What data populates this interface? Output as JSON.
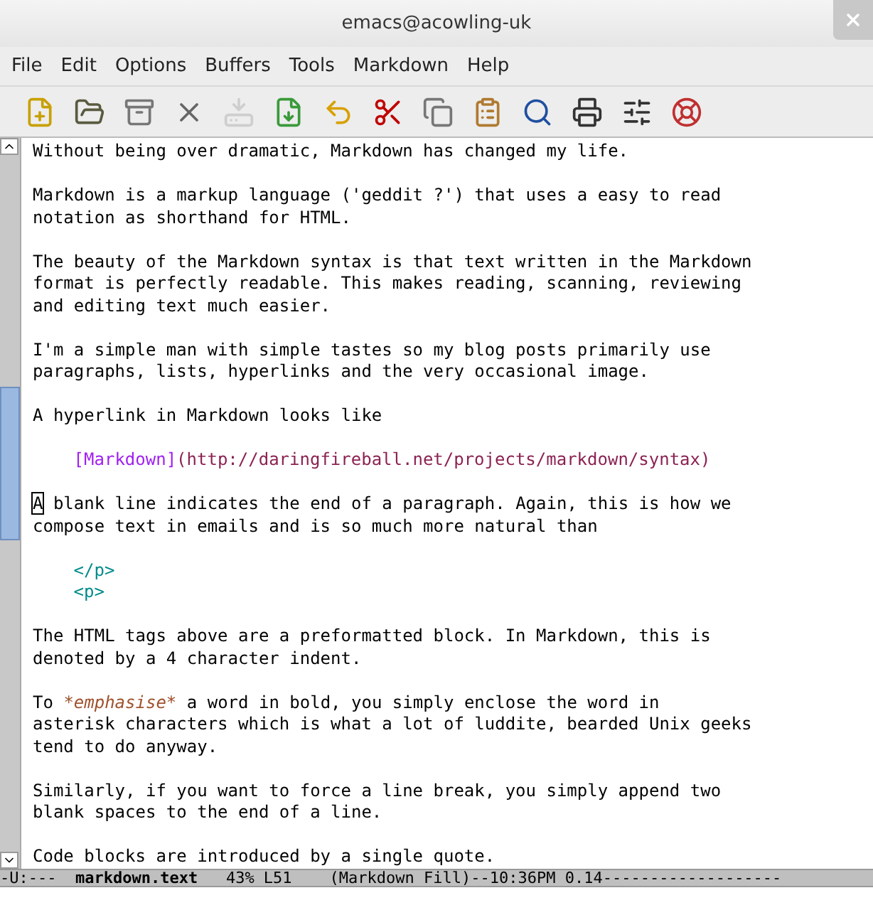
{
  "window": {
    "title": "emacs@acowling-uk"
  },
  "menu": [
    "File",
    "Edit",
    "Options",
    "Buffers",
    "Tools",
    "Markdown",
    "Help"
  ],
  "toolbar": [
    {
      "disabled": false
    },
    {
      "disabled": false
    },
    {
      "disabled": false
    },
    {
      "disabled": false
    },
    {
      "disabled": true
    },
    {
      "disabled": false
    },
    {
      "disabled": false
    },
    {
      "disabled": false
    },
    {
      "disabled": false
    },
    {
      "disabled": false
    },
    {
      "disabled": false
    },
    {
      "disabled": false
    },
    {
      "disabled": false
    },
    {
      "disabled": false
    }
  ],
  "buffer": {
    "lines": [
      {
        "kind": "text",
        "segments": [
          {
            "kind": "plain",
            "text": "Without being over dramatic, Markdown has changed my life."
          }
        ]
      },
      {
        "kind": "blank"
      },
      {
        "kind": "text",
        "segments": [
          {
            "kind": "plain",
            "text": "Markdown is a markup language ('geddit ?') that uses a easy to read"
          }
        ]
      },
      {
        "kind": "text",
        "segments": [
          {
            "kind": "plain",
            "text": "notation as shorthand for HTML."
          }
        ]
      },
      {
        "kind": "blank"
      },
      {
        "kind": "text",
        "segments": [
          {
            "kind": "plain",
            "text": "The beauty of the Markdown syntax is that text written in the Markdown"
          }
        ]
      },
      {
        "kind": "text",
        "segments": [
          {
            "kind": "plain",
            "text": "format is perfectly readable. This makes reading, scanning, reviewing"
          }
        ]
      },
      {
        "kind": "text",
        "segments": [
          {
            "kind": "plain",
            "text": "and editing text much easier."
          }
        ]
      },
      {
        "kind": "blank"
      },
      {
        "kind": "text",
        "segments": [
          {
            "kind": "plain",
            "text": "I'm a simple man with simple tastes so my blog posts primarily use"
          }
        ]
      },
      {
        "kind": "text",
        "segments": [
          {
            "kind": "plain",
            "text": "paragraphs, lists, hyperlinks and the very occasional image."
          }
        ]
      },
      {
        "kind": "blank"
      },
      {
        "kind": "text",
        "segments": [
          {
            "kind": "plain",
            "text": "A hyperlink in Markdown looks like"
          }
        ]
      },
      {
        "kind": "blank"
      },
      {
        "kind": "code",
        "segments": [
          {
            "kind": "link",
            "text": "[Markdown]"
          },
          {
            "kind": "url",
            "text": "(http://daringfireball.net/projects/markdown/syntax)"
          }
        ]
      },
      {
        "kind": "blank"
      },
      {
        "kind": "text",
        "segments": [
          {
            "kind": "cursor",
            "text": "A"
          },
          {
            "kind": "plain",
            "text": " blank line indicates the end of a paragraph. Again, this is how we"
          }
        ]
      },
      {
        "kind": "text",
        "segments": [
          {
            "kind": "plain",
            "text": "compose text in emails and is so much more natural than"
          }
        ]
      },
      {
        "kind": "blank"
      },
      {
        "kind": "code",
        "segments": [
          {
            "kind": "tag",
            "text": "</p>"
          }
        ]
      },
      {
        "kind": "code",
        "segments": [
          {
            "kind": "tag",
            "text": "<p>"
          }
        ]
      },
      {
        "kind": "blank"
      },
      {
        "kind": "text",
        "segments": [
          {
            "kind": "plain",
            "text": "The HTML tags above are a preformatted block. In Markdown, this is"
          }
        ]
      },
      {
        "kind": "text",
        "segments": [
          {
            "kind": "plain",
            "text": "denoted by a 4 character indent."
          }
        ]
      },
      {
        "kind": "blank"
      },
      {
        "kind": "text",
        "segments": [
          {
            "kind": "plain",
            "text": "To "
          },
          {
            "kind": "emphasis",
            "text": "*emphasise*"
          },
          {
            "kind": "plain",
            "text": " a word in bold, you simply enclose the word in"
          }
        ]
      },
      {
        "kind": "text",
        "segments": [
          {
            "kind": "plain",
            "text": "asterisk characters which is what a lot of luddite, bearded Unix geeks"
          }
        ]
      },
      {
        "kind": "text",
        "segments": [
          {
            "kind": "plain",
            "text": "tend to do anyway."
          }
        ]
      },
      {
        "kind": "blank"
      },
      {
        "kind": "text",
        "segments": [
          {
            "kind": "plain",
            "text": "Similarly, if you want to force a line break, you simply append two"
          }
        ]
      },
      {
        "kind": "text",
        "segments": [
          {
            "kind": "plain",
            "text": "blank spaces to the end of a line."
          }
        ]
      },
      {
        "kind": "blank"
      },
      {
        "kind": "text",
        "segments": [
          {
            "kind": "plain",
            "text": "Code blocks are introduced by a single quote."
          }
        ]
      }
    ]
  },
  "mode_line": "-U:---  **markdown.text**   43% L51    (Markdown Fill)--10:36PM 0.14-------------------"
}
